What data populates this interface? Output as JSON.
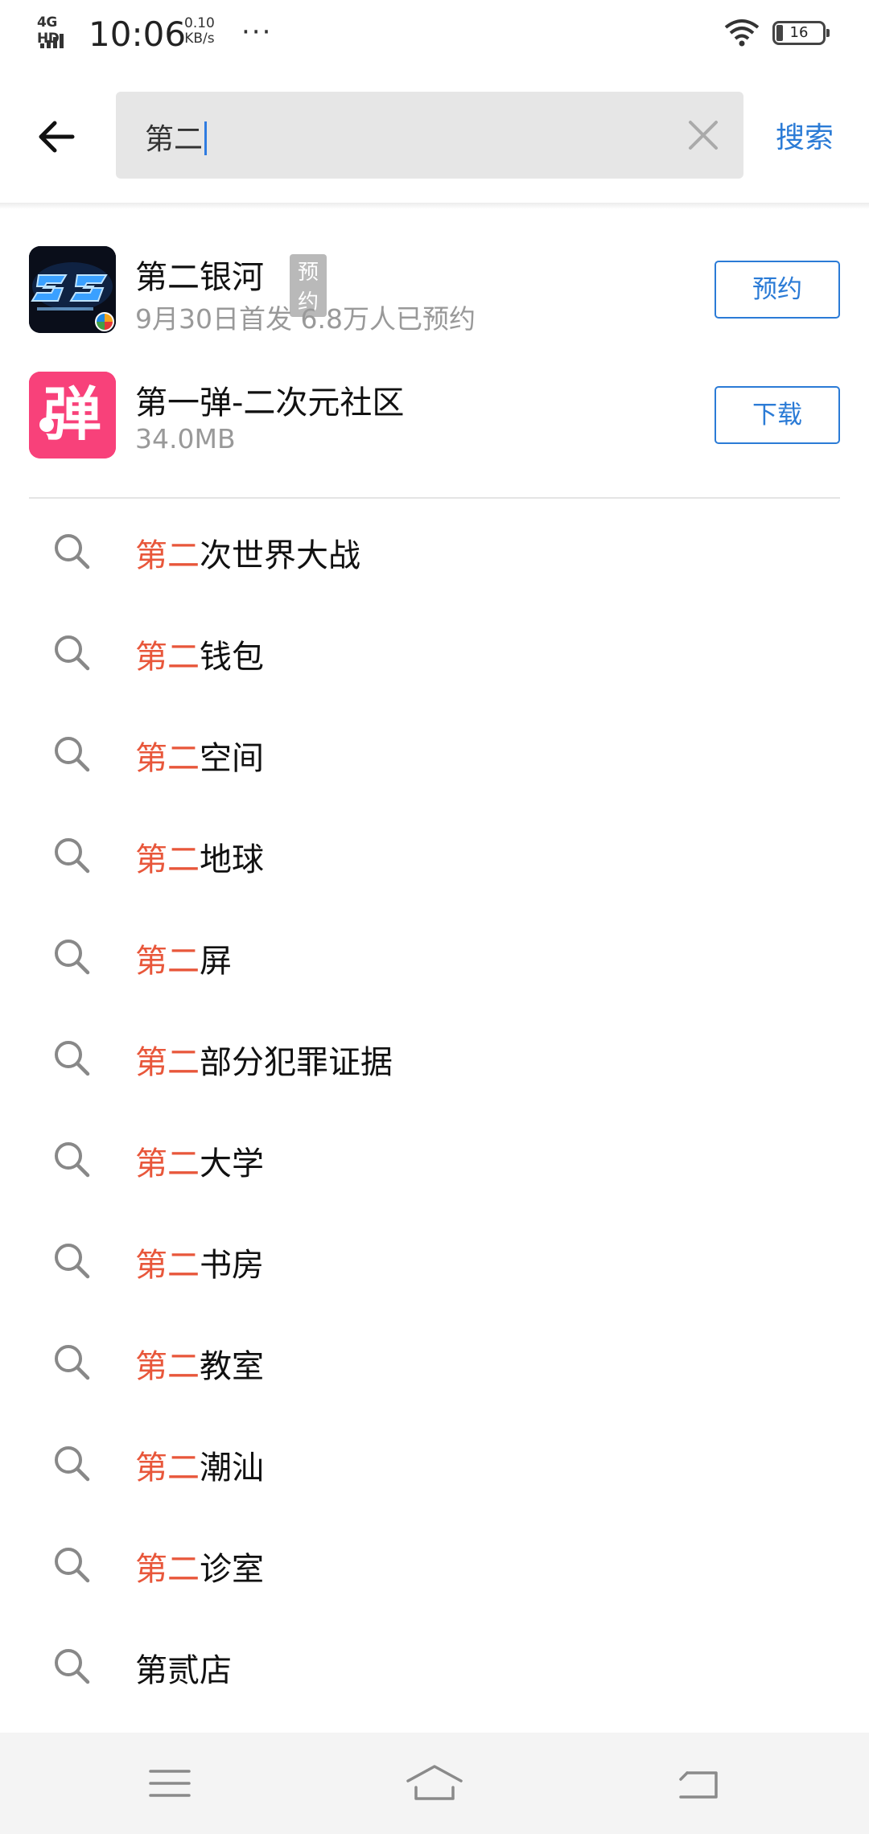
{
  "status_bar": {
    "network": "4G HD",
    "time": "10:06",
    "speed_value": "0.10",
    "speed_unit": "KB/s",
    "more": "···",
    "battery": "16"
  },
  "search": {
    "value": "第二",
    "search_button": "搜索"
  },
  "apps": [
    {
      "name": "第二银河",
      "tag": "预约",
      "subtitle": "9月30日首发 6.8万人已预约",
      "action": "预约",
      "icon": "second-galaxy-app-icon"
    },
    {
      "name": "第一弹-二次元社区",
      "subtitle": "34.0MB",
      "action": "下载",
      "icon": "dan-app-icon",
      "icon_glyph": "弹"
    }
  ],
  "suggestions": [
    {
      "highlight": "第二",
      "rest": "次世界大战"
    },
    {
      "highlight": "第二",
      "rest": "钱包"
    },
    {
      "highlight": "第二",
      "rest": "空间"
    },
    {
      "highlight": "第二",
      "rest": "地球"
    },
    {
      "highlight": "第二",
      "rest": "屏"
    },
    {
      "highlight": "第二",
      "rest": "部分犯罪证据"
    },
    {
      "highlight": "第二",
      "rest": "大学"
    },
    {
      "highlight": "第二",
      "rest": "书房"
    },
    {
      "highlight": "第二",
      "rest": "教室"
    },
    {
      "highlight": "第二",
      "rest": "潮汕"
    },
    {
      "highlight": "第二",
      "rest": "诊室"
    },
    {
      "highlight": "",
      "rest": "第贰店"
    }
  ],
  "colors": {
    "accent": "#2b7bd6",
    "highlight": "#e8573b",
    "tag_bg": "#b9b9b9"
  }
}
